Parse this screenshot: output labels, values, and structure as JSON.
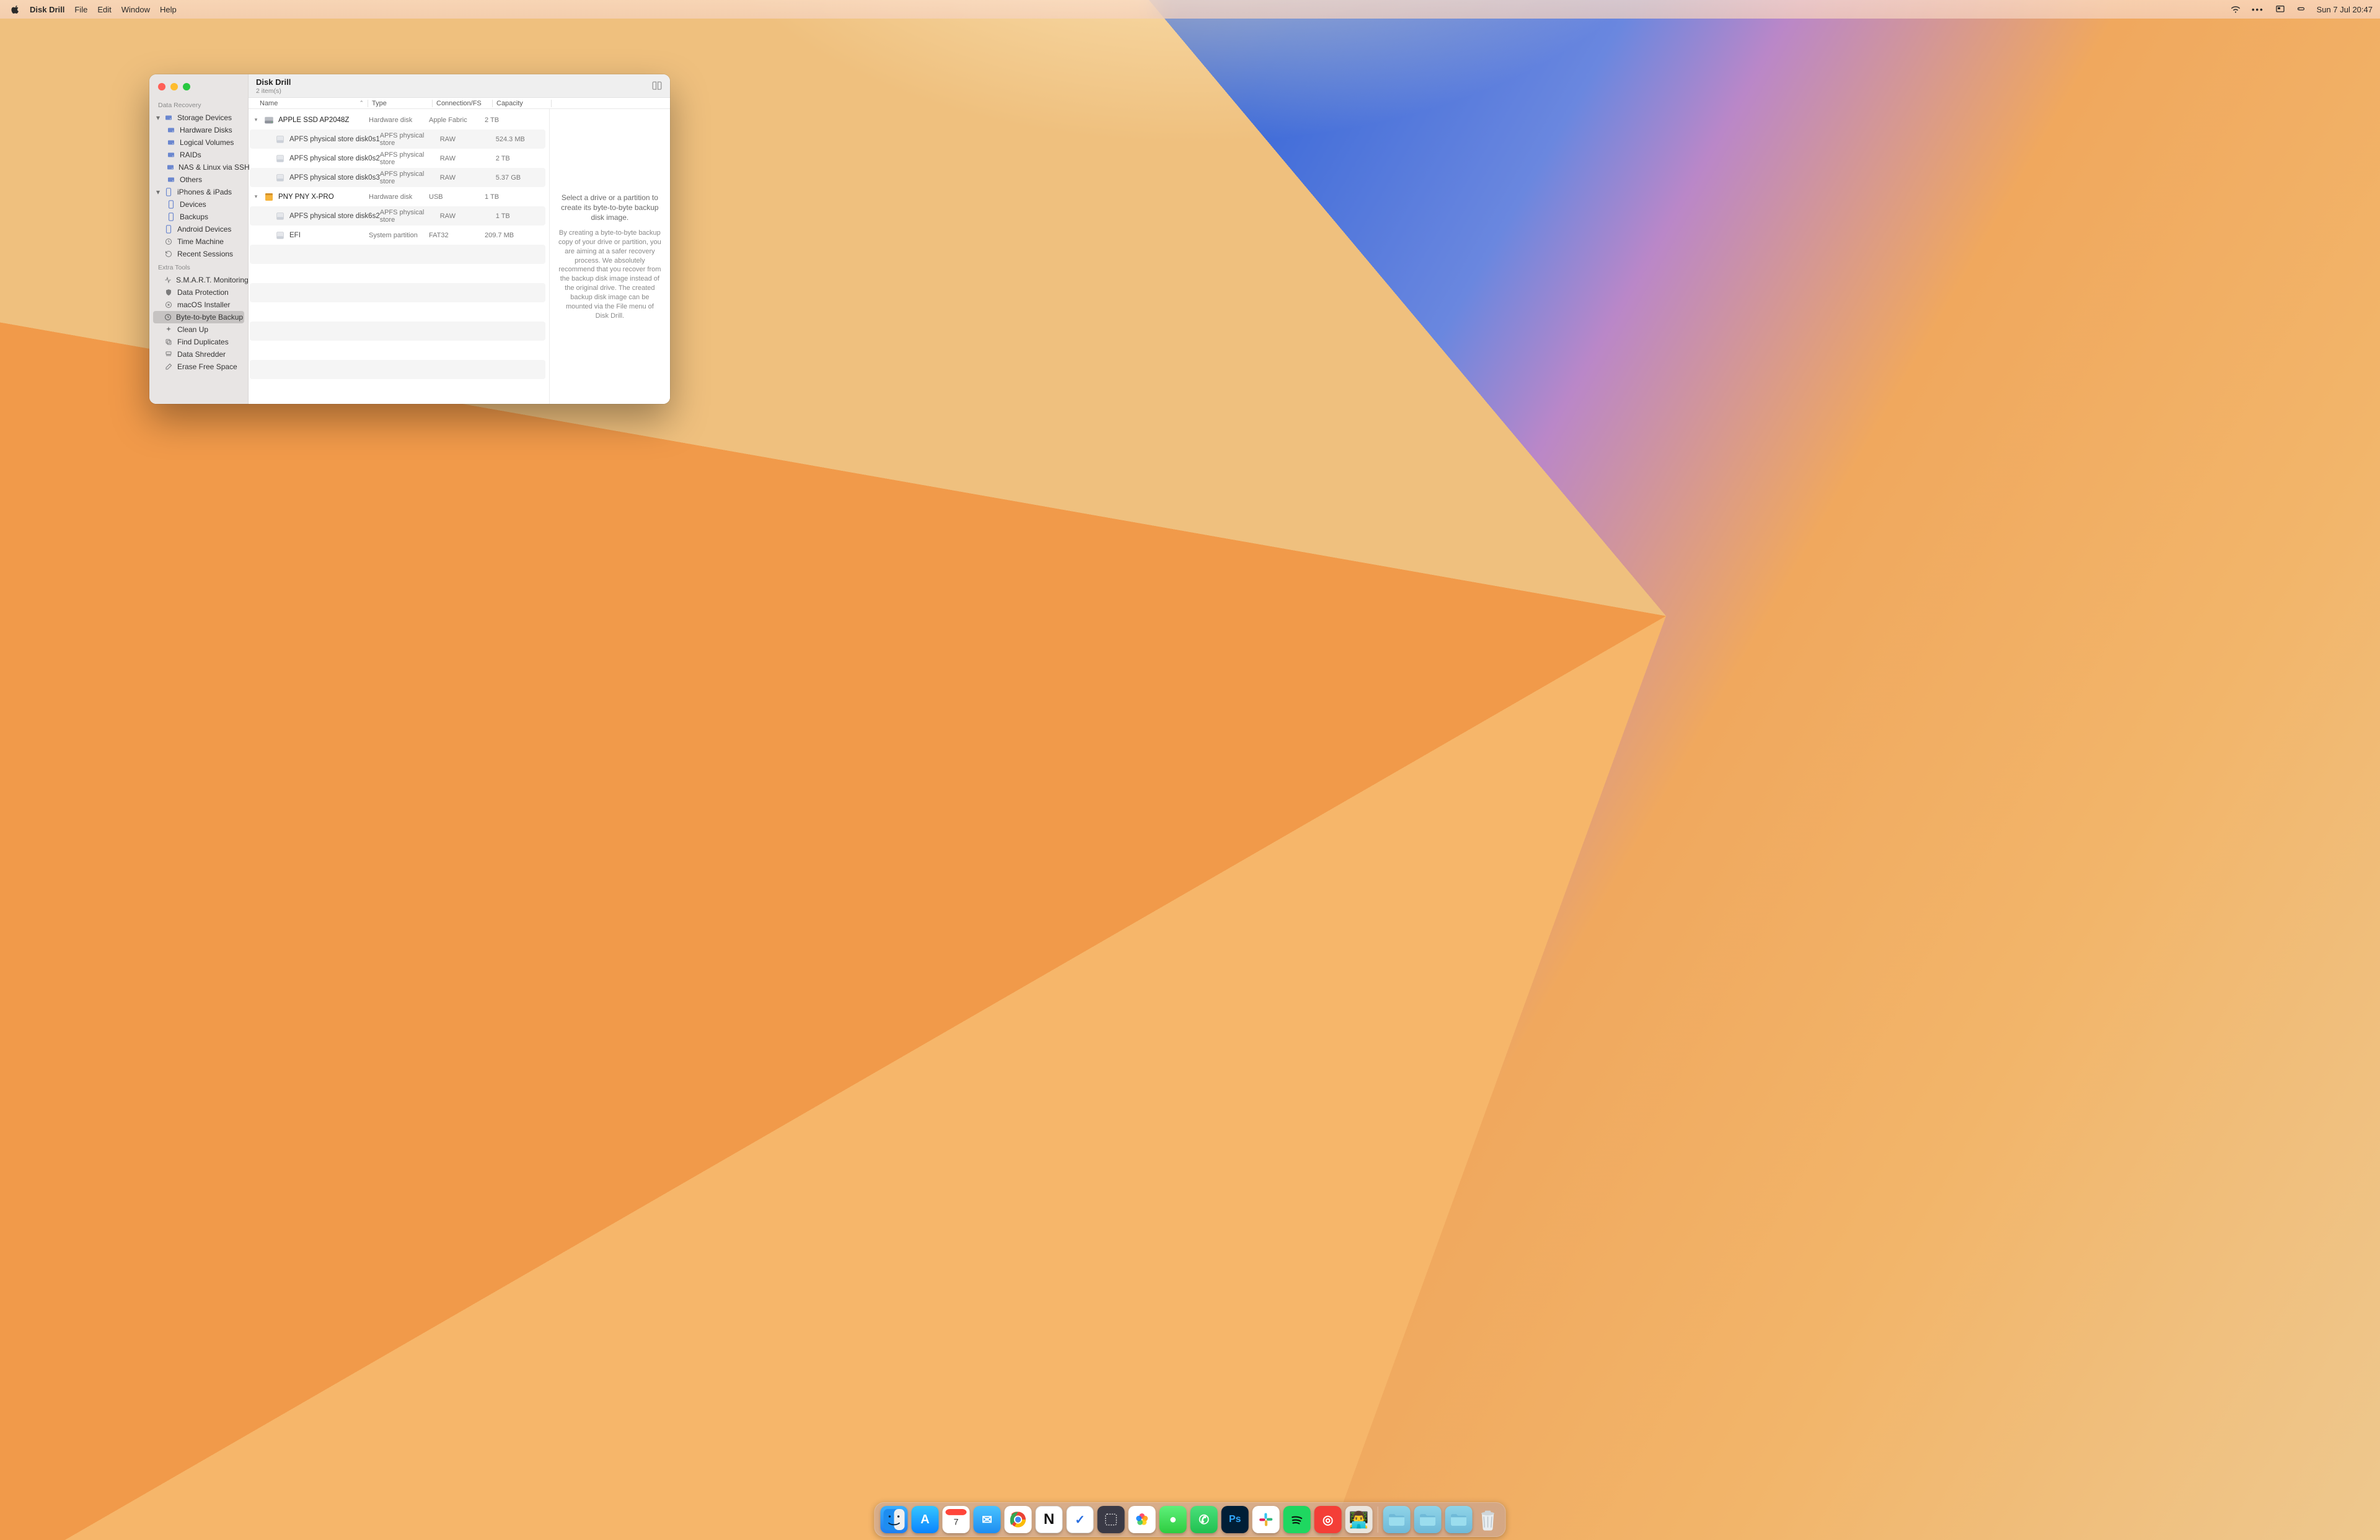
{
  "menubar": {
    "app": "Disk Drill",
    "menus": [
      "File",
      "Edit",
      "Window",
      "Help"
    ],
    "datetime": "Sun 7 Jul  20:47"
  },
  "sidebar": {
    "section_data_recovery": "Data Recovery",
    "storage_devices": "Storage Devices",
    "hardware_disks": "Hardware Disks",
    "logical_volumes": "Logical Volumes",
    "raids": "RAIDs",
    "nas_linux": "NAS & Linux via SSH",
    "others": "Others",
    "iphones_ipads": "iPhones & iPads",
    "devices": "Devices",
    "backups": "Backups",
    "android_devices": "Android Devices",
    "time_machine": "Time Machine",
    "recent_sessions": "Recent Sessions",
    "section_extra_tools": "Extra Tools",
    "smart": "S.M.A.R.T. Monitoring",
    "data_protection": "Data Protection",
    "macos_installer": "macOS Installer",
    "byte_to_byte": "Byte-to-byte Backup",
    "clean_up": "Clean Up",
    "find_duplicates": "Find Duplicates",
    "data_shredder": "Data Shredder",
    "erase_free_space": "Erase Free Space"
  },
  "title": {
    "app": "Disk Drill",
    "count": "2 item(s)"
  },
  "columns": {
    "name": "Name",
    "type": "Type",
    "conn": "Connection/FS",
    "cap": "Capacity"
  },
  "rows": [
    {
      "kind": "parent",
      "name": "APPLE SSD AP2048Z",
      "type": "Hardware disk",
      "conn": "Apple Fabric",
      "cap": "2 TB",
      "icon": "hdd-internal"
    },
    {
      "kind": "child",
      "name": "APFS physical store disk0s1",
      "type": "APFS physical store",
      "conn": "RAW",
      "cap": "524.3 MB",
      "icon": "volume"
    },
    {
      "kind": "child",
      "name": "APFS physical store disk0s2",
      "type": "APFS physical store",
      "conn": "RAW",
      "cap": "2 TB",
      "icon": "volume"
    },
    {
      "kind": "child",
      "name": "APFS physical store disk0s3",
      "type": "APFS physical store",
      "conn": "RAW",
      "cap": "5.37 GB",
      "icon": "volume"
    },
    {
      "kind": "parent",
      "name": "PNY PNY X-PRO",
      "type": "Hardware disk",
      "conn": "USB",
      "cap": "1 TB",
      "icon": "hdd-external"
    },
    {
      "kind": "child",
      "name": "APFS physical store disk6s2",
      "type": "APFS physical store",
      "conn": "RAW",
      "cap": "1 TB",
      "icon": "volume"
    },
    {
      "kind": "child",
      "name": "EFI",
      "type": "System partition",
      "conn": "FAT32",
      "cap": "209.7 MB",
      "icon": "volume"
    }
  ],
  "detail": {
    "line1": "Select a drive or a partition to create its byte-to-byte backup disk image.",
    "line2": "By creating a byte-to-byte backup copy of your drive or partition, you are aiming at a safer recovery process. We absolutely recommend that you recover from the backup disk image instead of the original drive. The created backup disk image can be mounted via the File menu of Disk Drill."
  },
  "dock": {
    "apps": [
      {
        "name": "finder",
        "bg": "linear-gradient(180deg,#3ab0ff,#1e7ef0)",
        "glyph": ""
      },
      {
        "name": "app-store",
        "bg": "linear-gradient(180deg,#34c5ff,#0a84ff)",
        "glyph": "A"
      },
      {
        "name": "calendar",
        "bg": "#ffffff",
        "glyph": ""
      },
      {
        "name": "mail",
        "bg": "linear-gradient(180deg,#4ac3ff,#1e8df0)",
        "glyph": "✉"
      },
      {
        "name": "chrome",
        "bg": "#ffffff",
        "glyph": ""
      },
      {
        "name": "notion",
        "bg": "#ffffff",
        "glyph": "N"
      },
      {
        "name": "things",
        "bg": "#ffffff",
        "glyph": "✓"
      },
      {
        "name": "pixelmator",
        "bg": "#3a3a46",
        "glyph": ""
      },
      {
        "name": "photos",
        "bg": "#ffffff",
        "glyph": ""
      },
      {
        "name": "messages",
        "bg": "linear-gradient(180deg,#5ef07a,#2ecc40)",
        "glyph": "●"
      },
      {
        "name": "whatsapp",
        "bg": "linear-gradient(180deg,#4ae07a,#20c050)",
        "glyph": "✆"
      },
      {
        "name": "photoshop",
        "bg": "#001e36",
        "glyph": "Ps"
      },
      {
        "name": "slack",
        "bg": "#ffffff",
        "glyph": ""
      },
      {
        "name": "spotify",
        "bg": "#1ed760",
        "glyph": ""
      },
      {
        "name": "pocketcasts",
        "bg": "#f43e37",
        "glyph": "◎"
      },
      {
        "name": "memoji",
        "bg": "#eae5de",
        "glyph": "👨‍💻"
      }
    ],
    "folders": [
      {
        "name": "folder-1"
      },
      {
        "name": "folder-2"
      },
      {
        "name": "folder-3"
      }
    ]
  }
}
